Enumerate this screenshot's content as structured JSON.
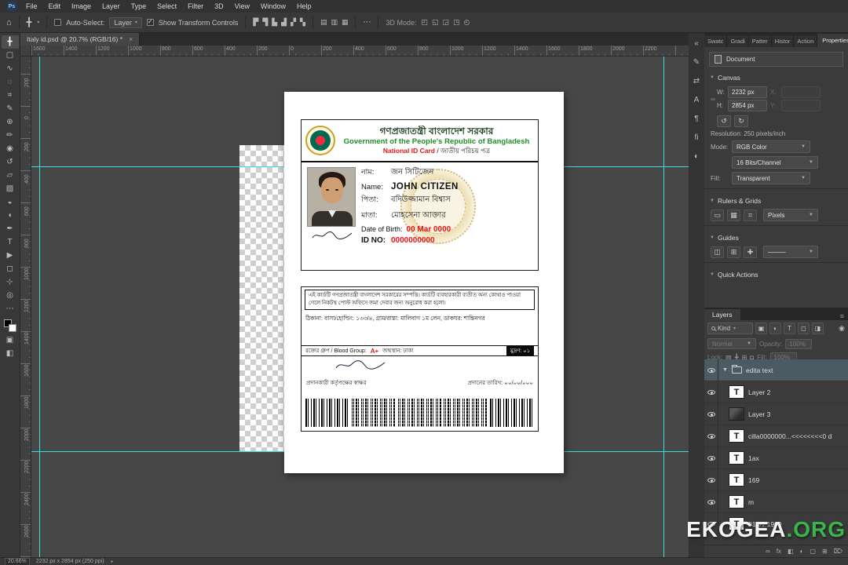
{
  "colors": {
    "guide_cyan": "#35dfe2",
    "card_red": "#e81212",
    "card_green": "#1f8f27",
    "seal_gold": "#d2b44a",
    "watermark_green": "#3ab54a"
  },
  "menubar": {
    "app_icon": "Ps",
    "items": [
      "File",
      "Edit",
      "Image",
      "Layer",
      "Type",
      "Select",
      "Filter",
      "3D",
      "View",
      "Window",
      "Help"
    ]
  },
  "options_bar": {
    "home_icon": "⌂",
    "tool_icon": "╋",
    "auto_select_label": "Auto-Select:",
    "auto_select_value": "Layer",
    "show_transform_label": "Show Transform Controls",
    "align_icons": [
      "▛",
      "▜",
      "▙",
      "▟",
      "▞",
      "▚"
    ],
    "distribute_icons": [
      "▤",
      "▥",
      "▦"
    ],
    "ellipsis": "⋯",
    "mode_3d_label": "3D Mode:",
    "mode_3d_icons": [
      "◰",
      "◱",
      "◲",
      "◳",
      "◴"
    ]
  },
  "document_tab": {
    "title": "Italy id.psd @ 20.7% (RGB/16) *",
    "close_icon": "×"
  },
  "rulers": {
    "top_labels": [
      "1600",
      "1400",
      "1200",
      "1000",
      "800",
      "600",
      "400",
      "200",
      "0",
      "200",
      "400",
      "600",
      "800",
      "1000",
      "1200",
      "1400",
      "1600",
      "1800",
      "2000",
      "2200"
    ],
    "left_labels": [
      "200",
      "0",
      "200",
      "400",
      "600",
      "800",
      "1000",
      "1200",
      "1400",
      "1600",
      "1800",
      "2000",
      "2200",
      "2400",
      "2600"
    ]
  },
  "tools": [
    {
      "name": "move-tool",
      "glyph": "╋"
    },
    {
      "name": "marquee-tool",
      "glyph": "▢"
    },
    {
      "name": "lasso-tool",
      "glyph": "∿"
    },
    {
      "name": "quick-selection-tool",
      "glyph": "◌"
    },
    {
      "name": "crop-tool",
      "glyph": "⌗"
    },
    {
      "name": "eyedropper-tool",
      "glyph": "✎"
    },
    {
      "name": "healing-brush-tool",
      "glyph": "⊕"
    },
    {
      "name": "brush-tool",
      "glyph": "✏"
    },
    {
      "name": "clone-stamp-tool",
      "glyph": "◉"
    },
    {
      "name": "history-brush-tool",
      "glyph": "↺"
    },
    {
      "name": "eraser-tool",
      "glyph": "▱"
    },
    {
      "name": "gradient-tool",
      "glyph": "▨"
    },
    {
      "name": "blur-tool",
      "glyph": "◒"
    },
    {
      "name": "dodge-tool",
      "glyph": "◖"
    },
    {
      "name": "pen-tool",
      "glyph": "✒"
    },
    {
      "name": "type-tool",
      "glyph": "T"
    },
    {
      "name": "path-selection-tool",
      "glyph": "▶"
    },
    {
      "name": "shape-tool",
      "glyph": "◻"
    },
    {
      "name": "hand-tool",
      "glyph": "⊹"
    },
    {
      "name": "zoom-tool",
      "glyph": "◎"
    },
    {
      "name": "more-tools",
      "glyph": "⋯"
    }
  ],
  "tools_bottom": [
    {
      "name": "quick-mask-tool",
      "glyph": "▣"
    },
    {
      "name": "screen-mode-tool",
      "glyph": "◧"
    }
  ],
  "right_strip": [
    {
      "name": "collapse-panels-icon",
      "glyph": "«"
    },
    {
      "name": "brush-settings-icon",
      "glyph": "✎"
    },
    {
      "name": "clone-source-icon",
      "glyph": "⇄"
    },
    {
      "name": "character-panel-icon",
      "glyph": "A"
    },
    {
      "name": "paragraph-panel-icon",
      "glyph": "¶"
    },
    {
      "name": "glyphs-panel-icon",
      "glyph": "ﬁ"
    },
    {
      "name": "3d-panel-icon",
      "glyph": "◐"
    }
  ],
  "card_front": {
    "header_bn": "গণপ্রজাতন্ত্রী বাংলাদেশ সরকার",
    "header_en": "Government of the People's Republic of Bangladesh",
    "header_id_en": "National ID Card",
    "header_id_bn": " / জাতীয় পরিচয় পত্র",
    "fields": [
      {
        "label": "নাম:",
        "value": "জন সিটিজেন",
        "red": false
      },
      {
        "label": "Name:",
        "value": "JOHN CITIZEN",
        "red": false
      },
      {
        "label": "পিতা:",
        "value": "বদিউজ্জামান বিশ্বাস",
        "red": false
      },
      {
        "label": "মাতা:",
        "value": "মোহসেনা আক্তার",
        "red": false
      },
      {
        "label": "Date of Birth:",
        "value": "00 Mar 0000",
        "red": true
      },
      {
        "label": "ID NO:",
        "value": "0000000000",
        "red": true
      }
    ]
  },
  "card_back": {
    "notice": "এই কার্ডটি গণপ্রজাতন্ত্রী বাংলাদেশ সরকারের সম্পত্তি। কার্ডটি ব্যবহারকারী ব্যতীত অন্য কোথাও পাওয়া গেলে নিকটস্থ পোস্ট অফিসে জমা দেবার জন্য অনুরোধ করা হলো।",
    "address": "ঠিকানা: বাসা/হোল্ডিং: ১৩৩/৪, গ্রাম/রাস্তা: মালিবাগ ১ম লেন, ডাকঘর: শান্তিনগর",
    "blood_label": "রক্তের গ্রুপ / Blood Group:",
    "blood_value": "A+",
    "birthplace": "জন্মস্থান: ঢাকা",
    "badge": "মুদ্রণ: ০১",
    "signature_label": "প্রদানকারী কর্তৃপক্ষের স্বাক্ষর",
    "issue_date_label": "প্রদানের তারিখ: ০০/০০/০০০"
  },
  "properties_panel": {
    "tabs": [
      "Swatc",
      "Gradi",
      "Patter",
      "Histor",
      "Action"
    ],
    "active_tab": "Properties",
    "document_label": "Document",
    "canvas_section": "Canvas",
    "w_label": "W:",
    "w_value": "2232 px",
    "h_label": "H:",
    "h_value": "2854 px",
    "x_label": "X:",
    "y_label": "Y:",
    "chain_icon": "∞",
    "rotate_left_icon": "↺",
    "rotate_right_icon": "↻",
    "resolution_text": "Resolution: 250 pixels/inch",
    "mode_label": "Mode:",
    "mode_value": "RGB Color",
    "depth_value": "16 Bits/Channel",
    "fill_label": "Fill:",
    "fill_value": "Transparent",
    "rulers_grids_section": "Rulers & Grids",
    "rulers_grids_icons": [
      "▭",
      "▦",
      "⌗"
    ],
    "units_value": "Pixels",
    "guides_section": "Guides",
    "guides_icons": [
      "◫",
      "⊞",
      "✚"
    ],
    "guides_style_value": "────",
    "quick_actions_section": "Quick Actions"
  },
  "layers_panel": {
    "tab_label": "Layers",
    "menu_icon": "≡",
    "kind_label": "Kind",
    "filter_icons": [
      "▣",
      "◐",
      "T",
      "◻",
      "◨"
    ],
    "toggle_icon": "◉",
    "blend_mode": "Normal",
    "opacity_label": "Opacity:",
    "opacity_value": "100%",
    "lock_label": "Lock:",
    "lock_icons": [
      "▨",
      "╋",
      "⊞",
      "◘"
    ],
    "fill_label": "Fill:",
    "fill_value": "100%",
    "layers": [
      {
        "type": "group",
        "name": "edita text",
        "selected": true
      },
      {
        "type": "text",
        "name": "Layer 2"
      },
      {
        "type": "image",
        "name": "Layer 3"
      },
      {
        "type": "text",
        "name": "cilla0000000...<<<<<<<<0 d"
      },
      {
        "type": "text",
        "name": "1ax"
      },
      {
        "type": "text",
        "name": "169"
      },
      {
        "type": "text",
        "name": "m"
      },
      {
        "type": "text",
        "name": "01.01.1900"
      }
    ],
    "bottom_icons": [
      {
        "name": "link-layers-icon",
        "glyph": "∞"
      },
      {
        "name": "layer-effects-icon",
        "glyph": "fx"
      },
      {
        "name": "layer-mask-icon",
        "glyph": "◧"
      },
      {
        "name": "adjustment-layer-icon",
        "glyph": "◐"
      },
      {
        "name": "layer-group-icon",
        "glyph": "▢"
      },
      {
        "name": "new-layer-icon",
        "glyph": "⊞"
      },
      {
        "name": "delete-layer-icon",
        "glyph": "⌦"
      }
    ]
  },
  "status_bar": {
    "zoom": "20.66%",
    "info": "2232 px x 2854 px (250 ppi)"
  },
  "watermark": {
    "white": "EKOGEA",
    "green": ".ORG"
  }
}
